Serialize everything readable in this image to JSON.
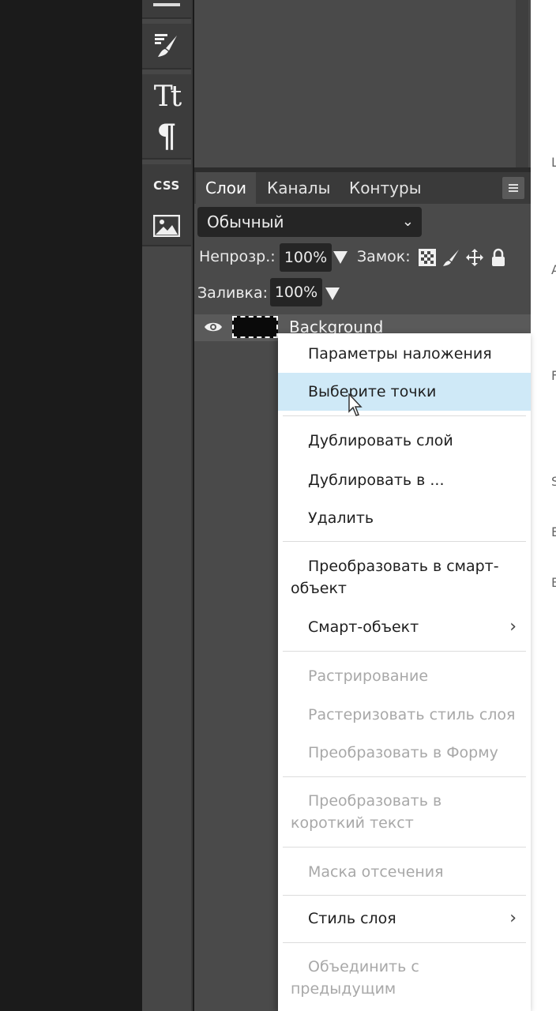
{
  "tools": [
    {
      "name": "brush-tool",
      "icon": "brush-icon"
    },
    {
      "name": "text-tool",
      "label": "Tt"
    },
    {
      "name": "paragraph-tool",
      "label": "¶"
    },
    {
      "name": "css-tool",
      "label": "CSS"
    },
    {
      "name": "image-tool",
      "icon": "image-icon"
    }
  ],
  "layers_panel": {
    "tabs": [
      "Слои",
      "Каналы",
      "Контуры"
    ],
    "active_tab": "Слои",
    "blend_mode": "Обычный",
    "opacity_label": "Непрозр.:",
    "opacity_value": "100%",
    "lock_label": "Замок:",
    "fill_label": "Заливка:",
    "fill_value": "100%",
    "layer": {
      "name": "Background",
      "visible": true
    }
  },
  "context_menu": {
    "items": [
      {
        "label": "Параметры наложения",
        "enabled": true
      },
      {
        "label": "Выберите точки",
        "enabled": true,
        "highlighted": true
      },
      {
        "label": "Дублировать слой",
        "enabled": true
      },
      {
        "label": "Дублировать в ...",
        "enabled": true
      },
      {
        "label": "Удалить",
        "enabled": true
      },
      {
        "label": "Преобразовать в смарт-объект",
        "enabled": true
      },
      {
        "label": "Смарт-объект",
        "enabled": true,
        "submenu": true
      },
      {
        "label": "Растрирование",
        "enabled": false
      },
      {
        "label": "Растеризовать стиль слоя",
        "enabled": false
      },
      {
        "label": "Преобразовать в Форму",
        "enabled": false
      },
      {
        "label": "Преобразовать в короткий текст",
        "enabled": false
      },
      {
        "label": "Маска отсечения",
        "enabled": false
      },
      {
        "label": "Стиль слоя",
        "enabled": true,
        "submenu": true
      },
      {
        "label": "Объединить с предыдущим",
        "enabled": false
      }
    ],
    "submenu_arrow": "›"
  },
  "right_strip_letters": [
    "L",
    "A",
    "F",
    "S",
    "E",
    "B"
  ],
  "colors": {
    "panel": "#4a4a4a",
    "menu_highlight": "#cfe9f7",
    "disabled_text": "#a8a8a8"
  }
}
